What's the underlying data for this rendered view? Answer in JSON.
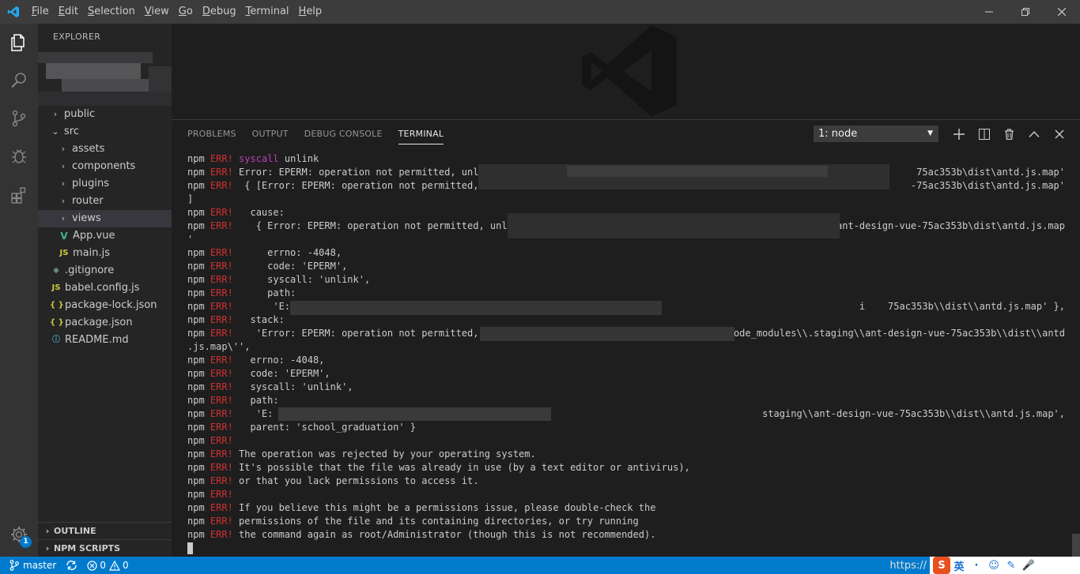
{
  "titlebar": {
    "menu": [
      {
        "label": "File",
        "mnemonic": "F",
        "rest": "ile"
      },
      {
        "label": "Edit",
        "mnemonic": "E",
        "rest": "dit"
      },
      {
        "label": "Selection",
        "mnemonic": "S",
        "rest": "election"
      },
      {
        "label": "View",
        "mnemonic": "V",
        "rest": "iew"
      },
      {
        "label": "Go",
        "mnemonic": "G",
        "rest": "o"
      },
      {
        "label": "Debug",
        "mnemonic": "D",
        "rest": "ebug"
      },
      {
        "label": "Terminal",
        "mnemonic": "T",
        "rest": "erminal"
      },
      {
        "label": "Help",
        "mnemonic": "H",
        "rest": "elp"
      }
    ]
  },
  "activitybar": {
    "icons": [
      "files-icon",
      "search-icon",
      "source-control-icon",
      "debug-icon",
      "extensions-icon"
    ],
    "settings_badge": "1"
  },
  "sidebar": {
    "title": "EXPLORER",
    "tree": [
      {
        "label": "public",
        "kind": "folder",
        "expanded": false,
        "depth": 1
      },
      {
        "label": "src",
        "kind": "folder",
        "expanded": true,
        "depth": 1
      },
      {
        "label": "assets",
        "kind": "folder",
        "expanded": false,
        "depth": 2
      },
      {
        "label": "components",
        "kind": "folder",
        "expanded": false,
        "depth": 2
      },
      {
        "label": "plugins",
        "kind": "folder",
        "expanded": false,
        "depth": 2
      },
      {
        "label": "router",
        "kind": "folder",
        "expanded": false,
        "depth": 2
      },
      {
        "label": "views",
        "kind": "folder",
        "expanded": false,
        "depth": 2,
        "selected": true
      },
      {
        "label": "App.vue",
        "kind": "vue",
        "depth": 2
      },
      {
        "label": "main.js",
        "kind": "js",
        "depth": 2
      },
      {
        "label": ".gitignore",
        "kind": "git",
        "depth": 1
      },
      {
        "label": "babel.config.js",
        "kind": "js",
        "depth": 1
      },
      {
        "label": "package-lock.json",
        "kind": "json",
        "depth": 1
      },
      {
        "label": "package.json",
        "kind": "json",
        "depth": 1
      },
      {
        "label": "README.md",
        "kind": "info",
        "depth": 1
      }
    ],
    "sections": [
      "OUTLINE",
      "NPM SCRIPTS"
    ]
  },
  "panel": {
    "tabs": [
      "PROBLEMS",
      "OUTPUT",
      "DEBUG CONSOLE",
      "TERMINAL"
    ],
    "active_tab": "TERMINAL",
    "terminal_select": "1: node",
    "terminal_lines": [
      {
        "p": "npm ",
        "e": "ERR!",
        "s": " ",
        "m": "syscall",
        "t": " unlink"
      },
      {
        "p": "npm ",
        "e": "ERR!",
        "t": " Error: EPERM: operation not permitted, unli",
        "tail": "75ac353b\\dist\\antd.js.map'"
      },
      {
        "p": "npm ",
        "e": "ERR!",
        "t": "  { [Error: EPERM: operation not permitted, u",
        "tail": "-75ac353b\\dist\\antd.js.map'"
      },
      {
        "p": "]",
        "e": "",
        "t": ""
      },
      {
        "p": "npm ",
        "e": "ERR!",
        "t": "   cause:"
      },
      {
        "p": "npm ",
        "e": "ERR!",
        "t": "    { Error: EPERM: operation not permitted, unli",
        "tail": "g\\ant-design-vue-75ac353b\\dist\\antd.js.map"
      },
      {
        "p": "'",
        "e": "",
        "t": ""
      },
      {
        "p": "npm ",
        "e": "ERR!",
        "t": "      errno: -4048,"
      },
      {
        "p": "npm ",
        "e": "ERR!",
        "t": "      code: 'EPERM',"
      },
      {
        "p": "npm ",
        "e": "ERR!",
        "t": "      syscall: 'unlink',"
      },
      {
        "p": "npm ",
        "e": "ERR!",
        "t": "      path:"
      },
      {
        "p": "npm ",
        "e": "ERR!",
        "t": "       'E:",
        "tail": "i    75ac353b\\\\dist\\\\antd.js.map' },"
      },
      {
        "p": "npm ",
        "e": "ERR!",
        "t": "   stack:"
      },
      {
        "p": "npm ",
        "e": "ERR!",
        "t": "    'Error: EPERM: operation not permitted, un",
        "tail": "node_modules\\\\.staging\\\\ant-design-vue-75ac353b\\\\dist\\\\antd"
      },
      {
        "p": ".js.map\\'',",
        "e": "",
        "t": ""
      },
      {
        "p": "npm ",
        "e": "ERR!",
        "t": "   errno: -4048,"
      },
      {
        "p": "npm ",
        "e": "ERR!",
        "t": "   code: 'EPERM',"
      },
      {
        "p": "npm ",
        "e": "ERR!",
        "t": "   syscall: 'unlink',"
      },
      {
        "p": "npm ",
        "e": "ERR!",
        "t": "   path:"
      },
      {
        "p": "npm ",
        "e": "ERR!",
        "t": "    'E:",
        "tail": "staging\\\\ant-design-vue-75ac353b\\\\dist\\\\antd.js.map',"
      },
      {
        "p": "npm ",
        "e": "ERR!",
        "t": "   parent: 'school_graduation' }"
      },
      {
        "p": "npm ",
        "e": "ERR!",
        "t": ""
      },
      {
        "p": "npm ",
        "e": "ERR!",
        "t": " The operation was rejected by your operating system."
      },
      {
        "p": "npm ",
        "e": "ERR!",
        "t": " It's possible that the file was already in use (by a text editor or antivirus),"
      },
      {
        "p": "npm ",
        "e": "ERR!",
        "t": " or that you lack permissions to access it."
      },
      {
        "p": "npm ",
        "e": "ERR!",
        "t": ""
      },
      {
        "p": "npm ",
        "e": "ERR!",
        "t": " If you believe this might be a permissions issue, please double-check the"
      },
      {
        "p": "npm ",
        "e": "ERR!",
        "t": " permissions of the file and its containing directories, or try running"
      },
      {
        "p": "npm ",
        "e": "ERR!",
        "t": " the command again as root/Administrator (though this is not recommended)."
      }
    ]
  },
  "statusbar": {
    "branch": "master",
    "errors": "0",
    "warnings": "0",
    "url": "https://"
  },
  "ime": {
    "items": [
      "S",
      "英",
      "·",
      "☺",
      "✎",
      "🎤"
    ]
  }
}
